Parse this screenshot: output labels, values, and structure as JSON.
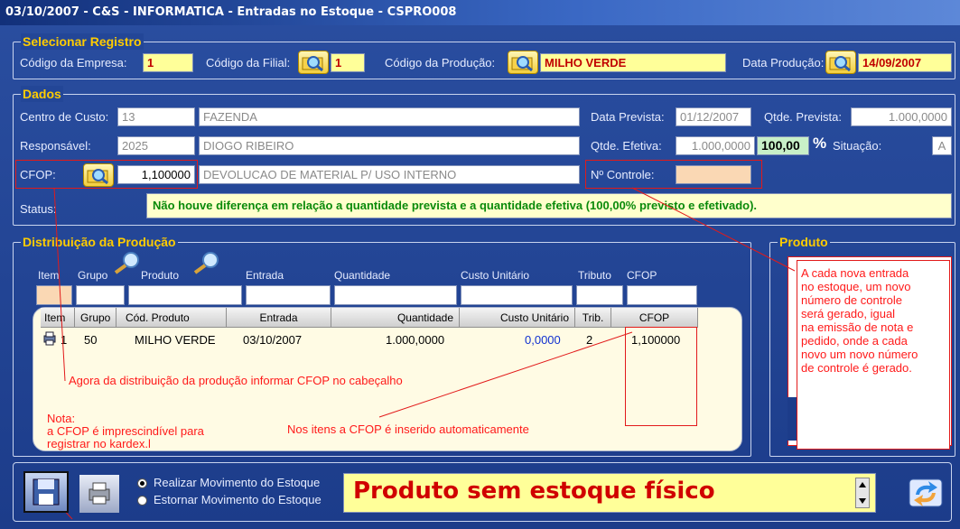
{
  "window": {
    "title": "03/10/2007 - C&S - INFORMATICA - Entradas no Estoque - CSPRO008"
  },
  "selecionar": {
    "legend": "Selecionar Registro",
    "empresa_label": "Código da Empresa:",
    "empresa_value": "1",
    "filial_label": "Código da Filial:",
    "filial_value": "1",
    "producao_label": "Código da Produção:",
    "producao_value": "MILHO VERDE",
    "data_label": "Data Produção:",
    "data_value": "14/09/2007"
  },
  "dados": {
    "legend": "Dados",
    "centro_label": "Centro de Custo:",
    "centro_code": "13",
    "centro_name": "FAZENDA",
    "resp_label": "Responsável:",
    "resp_code": "2025",
    "resp_name": "DIOGO RIBEIRO",
    "cfop_label": "CFOP:",
    "cfop_value": "1,100000",
    "cfop_desc": "DEVOLUCAO DE MATERIAL P/ USO INTERNO",
    "data_prevista_label": "Data Prevista:",
    "data_prevista_value": "01/12/2007",
    "qtde_prevista_label": "Qtde. Prevista:",
    "qtde_prevista_value": "1.000,0000",
    "qtde_efetiva_label": "Qtde. Efetiva:",
    "qtde_efetiva_value": "1.000,0000",
    "percent_value": "100,00",
    "percent_sign": "%",
    "situacao_label": "Situação:",
    "situacao_value": "A",
    "controle_label": "Nº Controle:",
    "status_label": "Status:",
    "status_text": "Não houve diferença em relação a quantidade prevista e a quantidade efetiva (100,00% previsto e efetivado)."
  },
  "distribuicao": {
    "legend": "Distribuição da Produção",
    "filter_headers": [
      "Item",
      "Grupo",
      "Produto",
      "Entrada",
      "Quantidade",
      "Custo Unitário",
      "Tributo",
      "CFOP"
    ],
    "columns": [
      "Item",
      "Grupo",
      "Cód. Produto",
      "Entrada",
      "Quantidade",
      "Custo Unitário",
      "Trib.",
      "CFOP"
    ],
    "rows": [
      {
        "item": "1",
        "grupo": "50",
        "produto": "MILHO VERDE",
        "entrada": "03/10/2007",
        "quantidade": "1.000,0000",
        "custo": "0,0000",
        "trib": "2",
        "cfop": "1,100000"
      }
    ]
  },
  "produto": {
    "legend": "Produto"
  },
  "annotations": {
    "cabecalho": "Agora da distribuição da produção informar CFOP no cabeçalho",
    "nota_1": "Nota:",
    "nota_2": "a CFOP é imprescindível para",
    "nota_3": "registrar no kardex.l",
    "itens": "Nos itens a CFOP é inserido automaticamente",
    "controle_1": "A cada nova entrada",
    "controle_2": "no estoque, um novo",
    "controle_3": "número de controle",
    "controle_4": "será gerado, igual",
    "controle_5": "na emissão de nota e",
    "controle_6": "pedido, onde a cada",
    "controle_7": "novo um novo número",
    "controle_8": "de controle é gerado."
  },
  "bottom": {
    "radio_1": "Realizar Movimento do Estoque",
    "radio_2": "Estornar Movimento do Estoque",
    "message": "Produto sem estoque físico"
  },
  "colors": {
    "accent_yellow": "#ffcc00",
    "annotation_red": "#ff1a1a",
    "status_green": "#0a8a0a"
  }
}
